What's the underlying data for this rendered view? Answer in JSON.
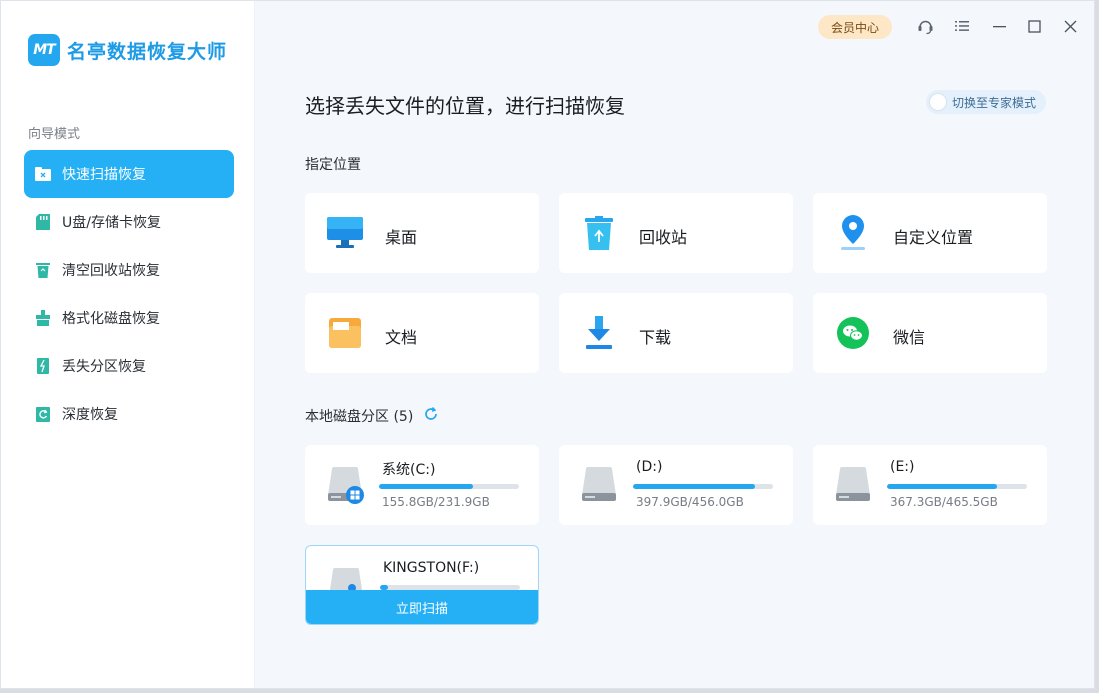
{
  "app": {
    "logo_mark": "MT",
    "title": "名亭数据恢复大师"
  },
  "sidebar": {
    "section_label": "向导模式",
    "items": [
      {
        "label": "快速扫描恢复",
        "icon": "folder-scan-icon",
        "active": true
      },
      {
        "label": "U盘/存储卡恢复",
        "icon": "sd-card-icon",
        "active": false
      },
      {
        "label": "清空回收站恢复",
        "icon": "recycle-bin-icon",
        "active": false
      },
      {
        "label": "格式化磁盘恢复",
        "icon": "format-disk-icon",
        "active": false
      },
      {
        "label": "丢失分区恢复",
        "icon": "lost-partition-icon",
        "active": false
      },
      {
        "label": "深度恢复",
        "icon": "deep-scan-icon",
        "active": false
      }
    ]
  },
  "titlebar": {
    "vip_label": "会员中心",
    "icons": [
      "support-headset-icon",
      "menu-icon",
      "minimize-icon",
      "maximize-icon",
      "close-icon"
    ]
  },
  "main": {
    "title": "选择丢失文件的位置，进行扫描恢复",
    "expert_toggle_label": "切换至专家模式",
    "locations_label": "指定位置",
    "locations": [
      {
        "label": "桌面",
        "icon": "desktop-monitor-icon"
      },
      {
        "label": "回收站",
        "icon": "recycle-bin-icon"
      },
      {
        "label": "自定义位置",
        "icon": "location-pin-icon"
      },
      {
        "label": "文档",
        "icon": "document-folder-icon"
      },
      {
        "label": "下载",
        "icon": "download-arrow-icon"
      },
      {
        "label": "微信",
        "icon": "wechat-icon"
      }
    ],
    "disks_label": "本地磁盘分区 (5)",
    "disks": [
      {
        "name": "系统(C:)",
        "size": "155.8GB/231.9GB",
        "used_fraction": 0.672,
        "system": true
      },
      {
        "name": "(D:)",
        "size": "397.9GB/456.0GB",
        "used_fraction": 0.873,
        "system": false
      },
      {
        "name": "(E:)",
        "size": "367.3GB/465.5GB",
        "used_fraction": 0.789,
        "system": false
      },
      {
        "name": "KINGSTON(F:)",
        "size": "",
        "used_fraction": 0.06,
        "system": false
      }
    ],
    "scan_button_label": "立即扫描"
  },
  "colors": {
    "accent": "#25b0f6",
    "brand": "#1e9be6",
    "vip_bg": "#fde7c7"
  }
}
